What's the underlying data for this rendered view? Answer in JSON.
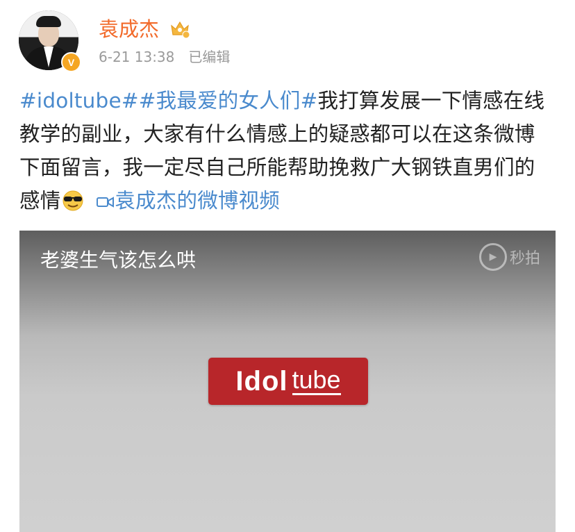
{
  "post": {
    "username": "袁成杰",
    "timestamp": "6-21 13:38",
    "edited_label": "已编辑",
    "verified_badge": "V",
    "hashtag_1": "#idoltube#",
    "hashtag_2": "#我最爱的女人们#",
    "body_1": "我打算发展一下情感在线教学的副业，大家有什么情感上的疑惑都可以在这条微博下面留言，我一定尽自己所能帮助挽救广大钢铁直男们的感情",
    "emoji": "cool-sunglasses-emoji",
    "video_link_label": "袁成杰的微博视频",
    "accent_color": "#4a8acd",
    "username_color": "#f26a2a"
  },
  "video": {
    "title": "老婆生气该怎么哄",
    "watermark": "秒拍",
    "logo_idol": "Idol",
    "logo_tube": "tube",
    "logo_color": "#b8262a"
  }
}
